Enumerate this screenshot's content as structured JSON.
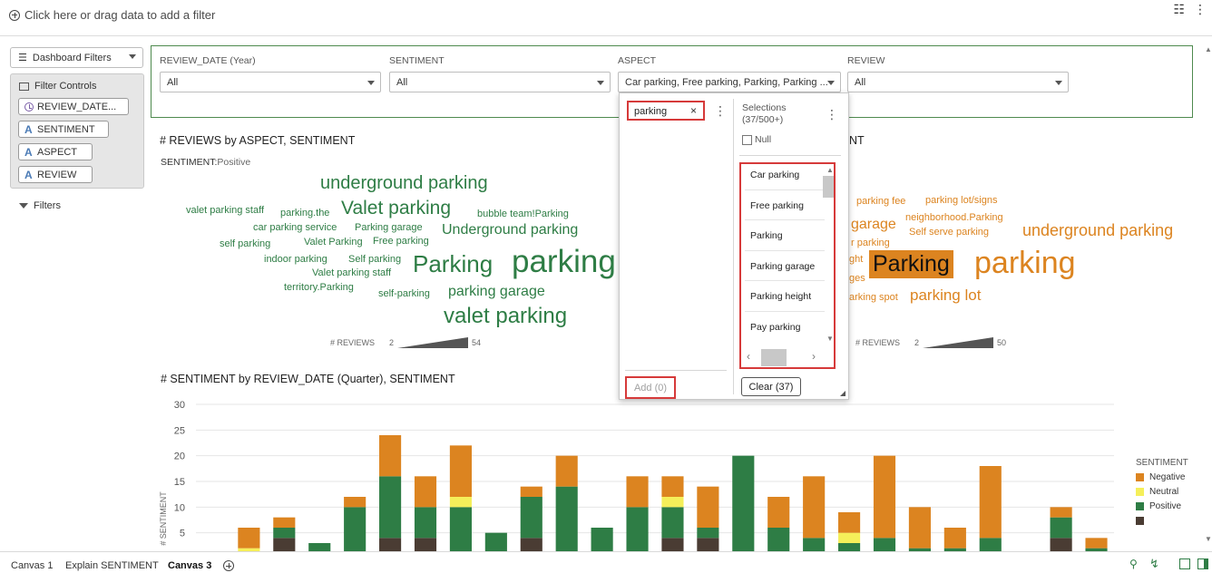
{
  "filterbar": {
    "add_filter_text": "Click here or drag data to add a filter"
  },
  "left_panel": {
    "dashboard_filters_label": "Dashboard Filters",
    "filter_controls_label": "Filter Controls",
    "chips": [
      "REVIEW_DATE...",
      "SENTIMENT",
      "ASPECT",
      "REVIEW"
    ],
    "filters_label": "Filters"
  },
  "controls": [
    {
      "label": "REVIEW_DATE (Year)",
      "value": "All"
    },
    {
      "label": "SENTIMENT",
      "value": "All"
    },
    {
      "label": "ASPECT",
      "value": "Car parking, Free parking, Parking, Parking ..."
    },
    {
      "label": "REVIEW",
      "value": "All"
    }
  ],
  "wordcloud_left": {
    "title": "# REVIEWS by ASPECT, SENTIMENT",
    "subtitle_key": "SENTIMENT:",
    "subtitle_value": "Positive",
    "words": [
      "underground parking",
      "valet parking staff",
      "parking.the",
      "Valet parking",
      "bubble team!Parking",
      "car parking service",
      "Parking garage",
      "Underground parking",
      "self parking",
      "Valet Parking",
      "Free parking",
      "indoor parking",
      "Self parking",
      "Parking",
      "parking",
      "Valet parking staff",
      "territory.Parking",
      "self-parking",
      "parking garage",
      "valet parking"
    ],
    "legend_label": "# REVIEWS",
    "legend_min": "2",
    "legend_max": "54"
  },
  "wordcloud_right": {
    "title_fragment": "NT",
    "words": [
      "parking fee",
      "parking lot/signs",
      "garage",
      "neighborhood.Parking",
      "Self serve parking",
      "underground parking",
      "r parking",
      "ght",
      "Parking",
      "parking",
      "ges",
      "arking spot",
      "parking lot"
    ],
    "legend_label": "# REVIEWS",
    "legend_min": "2",
    "legend_max": "50"
  },
  "popup": {
    "search_value": "parking",
    "clear_icon": "×",
    "selections_label": "Selections",
    "selections_count": "(37/500+)",
    "null_label": "Null",
    "selected_items": [
      "Car parking",
      "Free parking",
      "Parking",
      "Parking garage",
      "Parking height",
      "Pay parking"
    ],
    "add_label": "Add (0)",
    "clear_label": "Clear (37)"
  },
  "bar_chart_title": "# SENTIMENT by REVIEW_DATE (Quarter), SENTIMENT",
  "chart_data": {
    "type": "bar",
    "stacked": true,
    "ylabel": "# SENTIMENT",
    "yticks": [
      5,
      10,
      15,
      20,
      25,
      30
    ],
    "ylim": [
      0,
      30
    ],
    "grid": true,
    "legend_title": "SENTIMENT",
    "legend_position": "right",
    "series": [
      {
        "name": "Negative",
        "color": "#dc8420",
        "values": [
          0,
          4,
          2,
          0,
          2,
          8,
          6,
          10,
          0,
          2,
          6,
          0,
          6,
          4,
          8,
          0,
          6,
          12,
          4,
          16,
          8,
          4,
          14,
          0,
          2,
          2
        ]
      },
      {
        "name": "Neutral",
        "color": "#f5ef5a",
        "values": [
          0,
          2,
          0,
          0,
          0,
          0,
          0,
          2,
          0,
          0,
          0,
          0,
          0,
          2,
          0,
          0,
          0,
          0,
          2,
          0,
          0,
          0,
          0,
          0,
          0,
          0
        ]
      },
      {
        "name": "Positive",
        "color": "#2e7d45",
        "values": [
          1,
          0,
          2,
          3,
          10,
          12,
          6,
          10,
          5,
          8,
          14,
          6,
          10,
          6,
          2,
          20,
          6,
          4,
          3,
          4,
          2,
          2,
          4,
          1,
          4,
          2
        ]
      },
      {
        "name": "",
        "color": "#4a3c33",
        "values": [
          0,
          0,
          4,
          0,
          0,
          4,
          4,
          0,
          0,
          4,
          0,
          0,
          0,
          4,
          4,
          0,
          0,
          0,
          0,
          0,
          0,
          0,
          0,
          0,
          4,
          0
        ]
      }
    ]
  },
  "tabs": [
    "Canvas 1",
    "Explain SENTIMENT",
    "Canvas 3"
  ],
  "active_tab": "Canvas 3"
}
